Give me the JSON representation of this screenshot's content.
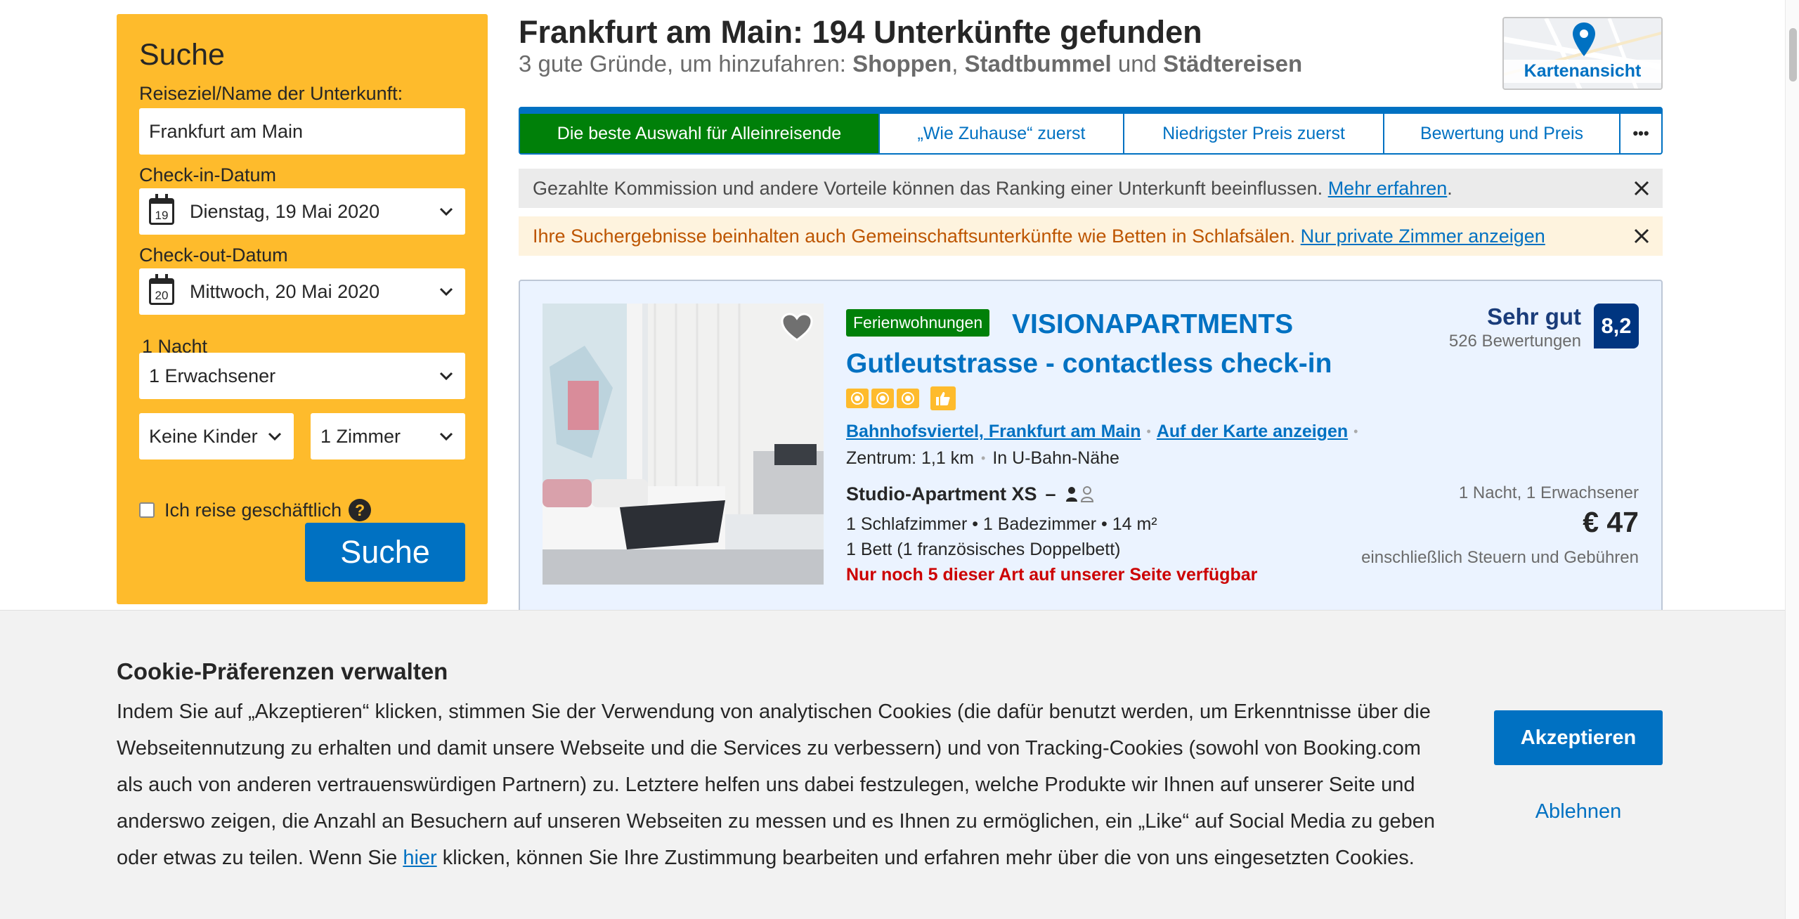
{
  "search": {
    "title": "Suche",
    "destination_label": "Reiseziel/Name der Unterkunft:",
    "destination_value": "Frankfurt am Main",
    "checkin_label": "Check-in-Datum",
    "checkin_day": "19",
    "checkin_value": "Dienstag, 19 Mai 2020",
    "checkout_label": "Check-out-Datum",
    "checkout_day": "20",
    "checkout_value": "Mittwoch, 20 Mai 2020",
    "nights": "1 Nacht",
    "adults": "1 Erwachsener",
    "children": "Keine Kinder",
    "rooms": "1 Zimmer",
    "business_label": "Ich reise geschäftlich",
    "help": "?",
    "button": "Suche"
  },
  "header": {
    "title": "Frankfurt am Main: 194 Unterkünfte gefunden",
    "reasons_prefix": "3 gute Gründe, um hinzufahren: ",
    "reason_1": "Shoppen",
    "sep_1": ", ",
    "reason_2": "Stadtbummel",
    "sep_2": " und ",
    "reason_3": "Städtereisen",
    "map_button": "Kartenansicht"
  },
  "sort_tabs": [
    {
      "label": "Die beste Auswahl für Alleinreisende",
      "active": true
    },
    {
      "label": "„Wie Zuhause“ zuerst",
      "active": false
    },
    {
      "label": "Niedrigster Preis zuerst",
      "active": false
    },
    {
      "label": "Bewertung und Preis",
      "active": false
    },
    {
      "label": "•••",
      "active": false
    }
  ],
  "notices": {
    "commission_text": "Gezahlte Kommission und andere Vorteile können das Ranking einer Unterkunft beeinflussen. ",
    "commission_link": "Mehr erfahren",
    "commission_end": ".",
    "shared_text": "Ihre Suchergebnisse beinhalten auch Gemeinschaftsunterkünfte wie Betten in Schlafsälen. ",
    "shared_link": "Nur private Zimmer anzeigen"
  },
  "property": {
    "type_badge": "Ferienwohnungen",
    "name": "VISIONAPARTMENTS Gutleutstrasse - contactless check-in",
    "stars": 3,
    "district": "Bahnhofsviertel, Frankfurt am Main",
    "map_link": "Auf der Karte anzeigen",
    "distance": "Zentrum: 1,1 km",
    "transit": "In U-Bahn-Nähe",
    "room_name": "Studio-Apartment XS",
    "room_dash": "–",
    "room_facilities": "1 Schlafzimmer • 1 Badezimmer • 14 m²",
    "room_beds": "1 Bett (1 französisches Doppelbett)",
    "availability": "Nur noch 5 dieser Art auf unserer Seite verfügbar",
    "review_word": "Sehr gut",
    "review_count": "526 Bewertungen",
    "score": "8,2",
    "price_meta": "1 Nacht, 1 Erwachsener",
    "price": "€ 47",
    "price_tax": "einschließlich Steuern und Gebühren"
  },
  "cookie": {
    "title": "Cookie-Präferenzen verwalten",
    "text_before_link": "Indem Sie auf „Akzeptieren“ klicken, stimmen Sie der Verwendung von analytischen Cookies (die dafür benutzt werden, um Erkenntnisse über die Webseitennutzung zu erhalten und damit unsere Webseite und die Services zu verbessern) und von Tracking-Cookies (sowohl von Booking.com als auch von anderen vertrauenswürdigen Partnern) zu. Letztere helfen uns dabei festzulegen, welche Produkte wir Ihnen auf unserer Seite und anderswo zeigen, die Anzahl an Besuchern auf unseren Webseiten zu messen und es Ihnen zu ermöglichen, ein „Like“ auf Social Media zu geben oder etwas zu teilen. Wenn Sie ",
    "link": "hier",
    "text_after_link": " klicken, können Sie Ihre Zustimmung bearbeiten und erfahren mehr über die von uns eingesetzten Cookies.",
    "accept": "Akzeptieren",
    "decline": "Ablehnen"
  },
  "colors": {
    "brand_blue": "#0071c2",
    "search_yellow": "#febb2c",
    "active_green": "#008009",
    "score_navy": "#003580",
    "warning_red": "#cc0000"
  }
}
